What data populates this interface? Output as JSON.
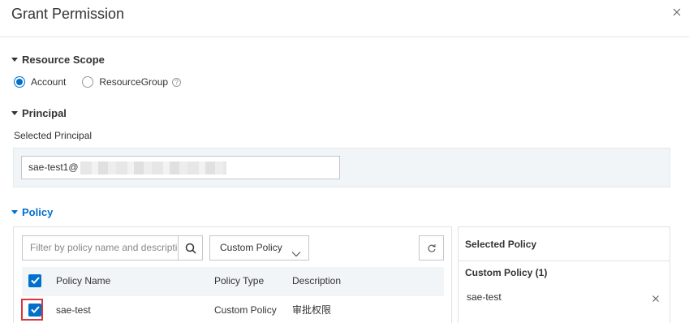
{
  "dialog": {
    "title": "Grant Permission"
  },
  "resource_scope": {
    "heading": "Resource Scope",
    "options": [
      {
        "label": "Account",
        "checked": true
      },
      {
        "label": "ResourceGroup",
        "checked": false
      }
    ]
  },
  "principal": {
    "heading": "Principal",
    "selected_label": "Selected Principal",
    "value": "sae-test1@"
  },
  "policy": {
    "heading": "Policy",
    "filter_placeholder": "Filter by policy name and description",
    "type_select": "Custom Policy",
    "table": {
      "columns": [
        "Policy Name",
        "Policy Type",
        "Description"
      ],
      "rows": [
        {
          "name": "sae-test",
          "type": "Custom Policy",
          "description": "审批权限",
          "checked": true
        }
      ]
    },
    "selected": {
      "title": "Selected Policy",
      "group": "Custom Policy (1)",
      "items": [
        "sae-test"
      ]
    }
  },
  "colors": {
    "accent": "#0070cc",
    "highlight": "#d9363e"
  }
}
